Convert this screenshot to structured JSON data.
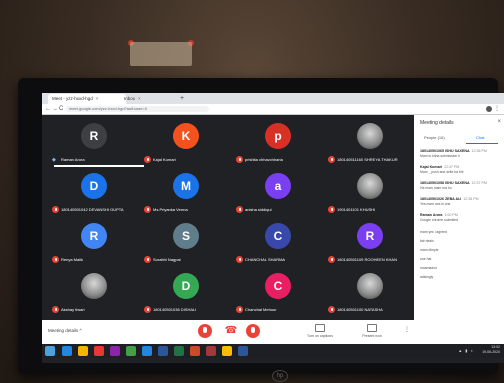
{
  "browser": {
    "tabs": [
      {
        "label": "Meet - yzz-hxxd-hgd",
        "active": true
      },
      {
        "label": "Inbox",
        "active": false
      }
    ],
    "url": "meet.google.com/yzz-hxxd-hgd?authuser=0",
    "nav_back": "←",
    "nav_forward": "→",
    "nav_reload": "C",
    "new_tab": "+",
    "tab_close": "×",
    "menu": "⋮"
  },
  "participants": [
    {
      "name": "Raman Arora",
      "initial": "R",
      "color": "#3c4043",
      "speaking": true
    },
    {
      "name": "Kajal Kumari",
      "initial": "K",
      "color": "#f4511e"
    },
    {
      "name": "prishita chhavchharia",
      "initial": "p",
      "color": "#d93025"
    },
    {
      "name": "180140511160 SHREYA THAKUR",
      "initial": "",
      "photo": true
    },
    {
      "name": "180140501042 DEVANSHI GUPTA",
      "initial": "D",
      "color": "#1a73e8"
    },
    {
      "name": "Ms.Priyanka Verma",
      "initial": "M",
      "color": "#1a73e8"
    },
    {
      "name": "anisha siddiqui",
      "initial": "a",
      "color": "#7b3ff2"
    },
    {
      "name": "1901401101 KHUSHI",
      "initial": "",
      "photo": true
    },
    {
      "name": "Renya Malik",
      "initial": "R",
      "color": "#4285f4"
    },
    {
      "name": "Surabhi Nagpal",
      "initial": "S",
      "color": "#607d8b"
    },
    {
      "name": "CHANCHAL SHARMA",
      "initial": "C",
      "color": "#3949ab"
    },
    {
      "name": "180140501109 ROOHEEN KHAN",
      "initial": "R",
      "color": "#7b3ff2"
    },
    {
      "name": "Akshay tiwari",
      "initial": "",
      "photo": true
    },
    {
      "name": "180140501036 DISHALI",
      "initial": "D",
      "color": "#34a853"
    },
    {
      "name": "Chanchal Mehour",
      "initial": "C",
      "color": "#e91e63"
    },
    {
      "name": "180140501100 NATASHA",
      "initial": "",
      "photo": true
    }
  ],
  "panel": {
    "title": "Meeting details",
    "close": "×",
    "tab_people": "People (16)",
    "tab_chat": "Chat",
    "messages": [
      {
        "author": "180140501065 ISHU SAXENA",
        "time": "12:36 PM",
        "text": "Mam to kitna submission h"
      },
      {
        "author": "Kajal Kumari",
        "time": "12:37 PM",
        "text": "Mam _ push and write ka bhi"
      },
      {
        "author": "180140501058 ISHU SAXENA",
        "time": "12:37 PM",
        "text": "Ha mam mam ma ho"
      },
      {
        "author": "180140501026 ZEBA ALI",
        "time": "12:38 PM",
        "text": "Yes mam ans is one"
      },
      {
        "author": "Raman Arora",
        "time": "1:00 PM",
        "text": "Google chrome submited"
      },
      {
        "author": "",
        "time": "",
        "text": "mam yes i agreed"
      },
      {
        "author": "",
        "time": "",
        "text": "fair deals"
      },
      {
        "author": "",
        "time": "",
        "text": "mam dimple"
      },
      {
        "author": "",
        "time": "",
        "text": "one hat"
      },
      {
        "author": "",
        "time": "",
        "text": "maamadon"
      },
      {
        "author": "",
        "time": "",
        "text": "adisingly"
      }
    ]
  },
  "controls": {
    "meeting_details": "Meeting details  ^",
    "end_call": "☎",
    "captions": "Turn on captions",
    "present": "Present now",
    "more": "⋮"
  },
  "taskbar": {
    "time": "13:02",
    "date": "19-06-2020",
    "icons": [
      {
        "name": "ie",
        "color": "#1e88e5"
      },
      {
        "name": "explorer",
        "color": "#f4b400"
      },
      {
        "name": "media",
        "color": "#e53935"
      },
      {
        "name": "app",
        "color": "#8e24aa"
      },
      {
        "name": "store",
        "color": "#43a047"
      },
      {
        "name": "mail",
        "color": "#1e88e5"
      },
      {
        "name": "word",
        "color": "#2b579a"
      },
      {
        "name": "excel",
        "color": "#217346"
      },
      {
        "name": "ppt",
        "color": "#d24726"
      },
      {
        "name": "access",
        "color": "#a4373a"
      },
      {
        "name": "chrome",
        "color": "#fbbc05"
      },
      {
        "name": "word2",
        "color": "#2b579a"
      }
    ]
  }
}
